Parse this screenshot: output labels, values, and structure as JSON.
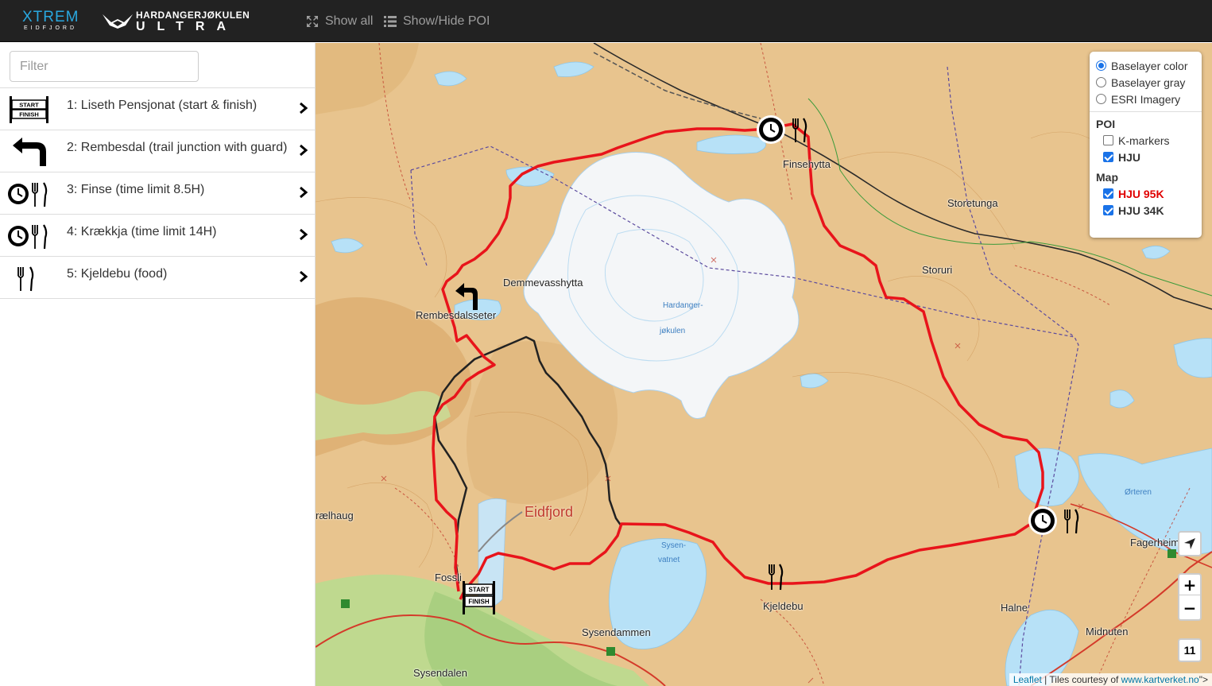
{
  "navbar": {
    "brand_xtrem": "XTREM",
    "brand_xtrem_sub": "EIDFJORD",
    "brand_hju_top": "HARDANGERJØKULEN",
    "brand_hju_bottom": "ULTRA",
    "show_all_label": "Show all",
    "show_hide_poi_label": "Show/Hide POI"
  },
  "sidebar": {
    "filter_placeholder": "Filter",
    "items": [
      {
        "label": "1: Liseth Pensjonat (start & finish)",
        "icon": "start-finish-icon"
      },
      {
        "label": "2: Rembesdal (trail junction with guard)",
        "icon": "turn-left-arrow-icon"
      },
      {
        "label": "3: Finse (time limit 8.5H)",
        "icon": "clock-food-icon"
      },
      {
        "label": "4: Krækkja (time limit 14H)",
        "icon": "clock-food-icon"
      },
      {
        "label": "5: Kjeldebu (food)",
        "icon": "food-icon"
      }
    ]
  },
  "map": {
    "labels": {
      "demmevasshytta": "Demmevasshytta",
      "rembesdalsseter": "Rembesdalsseter",
      "finsehytta": "Finsehytta",
      "storetunga": "Storetunga",
      "storuri": "Storuri",
      "eidfjord": "Eidfjord",
      "kjeldebu": "Kjeldebu",
      "sysendammen": "Sysendammen",
      "sysendalen": "Sysendalen",
      "fossli": "Fossli",
      "fagerheim": "Fagerheim",
      "midnuten": "Midnuten",
      "halne": "Halne",
      "hardangerjokulen_1": "Hardanger-",
      "hardangerjokulen_2": "jøkulen",
      "sysenvatnet_1": "Sysen-",
      "sysenvatnet_2": "vatnet",
      "orteren": "Ørteren",
      "kraelhaug": "rælhaug",
      "start": "START",
      "finish": "FINISH"
    },
    "layer_control": {
      "baselayers": [
        {
          "label": "Baselayer color",
          "selected": true
        },
        {
          "label": "Baselayer gray",
          "selected": false
        },
        {
          "label": "ESRI Imagery",
          "selected": false
        }
      ],
      "poi_title": "POI",
      "poi": [
        {
          "label": "K-markers",
          "checked": false
        },
        {
          "label": "HJU",
          "checked": true
        }
      ],
      "map_title": "Map",
      "map": [
        {
          "label": "HJU 95K",
          "checked": true,
          "color": "#e00000"
        },
        {
          "label": "HJU 34K",
          "checked": true,
          "color": "#000000"
        }
      ]
    },
    "zoom_in": "+",
    "zoom_out": "−",
    "zoom_level": "11",
    "attribution_leaflet": "Leaflet",
    "attribution_text": " | Tiles courtesy of ",
    "attribution_link": "www.kartverket.no",
    "attribution_tail": "\">",
    "colors": {
      "route_95k": "#e8141b",
      "route_34k": "#222222",
      "terrain": "#e8c48e",
      "water": "#b7e1f7",
      "glacier": "#f4f6f8"
    }
  }
}
